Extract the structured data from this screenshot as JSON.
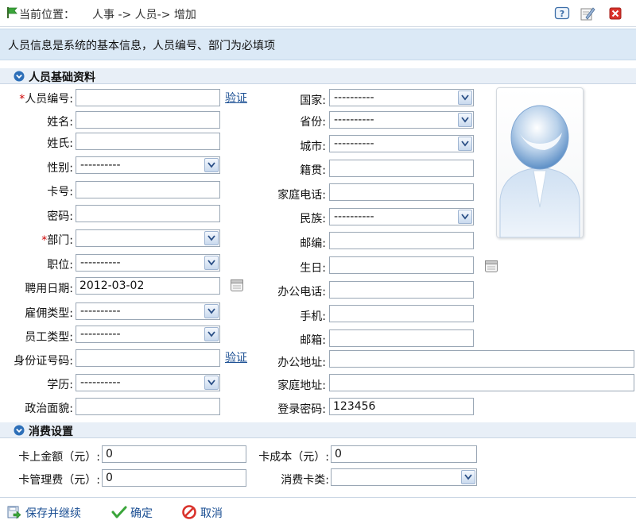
{
  "breadcrumb": {
    "label": "当前位置：",
    "path": "人事  -> 人员-> 增加"
  },
  "toolbar": {
    "help_icon": "help-icon",
    "edit_icon": "edit-icon",
    "close_icon": "close-icon"
  },
  "banner": {
    "text": "人员信息是系统的基本信息，人员编号、部门为必填项"
  },
  "section_basic": {
    "title": "人员基础资料"
  },
  "section_consume": {
    "title": "消费设置"
  },
  "left_fields": {
    "emp_no": {
      "required_mark": "*",
      "label": "人员编号:",
      "value": "",
      "verify_link": "验证"
    },
    "name": {
      "label": "姓名:",
      "value": ""
    },
    "surname": {
      "label": "姓氏:",
      "value": ""
    },
    "gender": {
      "label": "性别:",
      "value": "----------"
    },
    "card_no": {
      "label": "卡号:",
      "value": ""
    },
    "password": {
      "label": "密码:",
      "value": ""
    },
    "department": {
      "required_mark": "*",
      "label": "部门:",
      "value": ""
    },
    "position": {
      "label": "职位:",
      "value": "----------"
    },
    "hire_date": {
      "label": "聘用日期:",
      "value": "2012-03-02"
    },
    "employ_type": {
      "label": "雇佣类型:",
      "value": "----------"
    },
    "staff_type": {
      "label": "员工类型:",
      "value": "----------"
    },
    "id_no": {
      "label": "身份证号码:",
      "value": "",
      "verify_link": "验证"
    },
    "education": {
      "label": "学历:",
      "value": "----------"
    },
    "politics": {
      "label": "政治面貌:",
      "value": ""
    }
  },
  "right_fields": {
    "country": {
      "label": "国家:",
      "value": "----------"
    },
    "province": {
      "label": "省份:",
      "value": "----------"
    },
    "city": {
      "label": "城市:",
      "value": "----------"
    },
    "native_place": {
      "label": "籍贯:",
      "value": ""
    },
    "home_phone": {
      "label": "家庭电话:",
      "value": ""
    },
    "ethnicity": {
      "label": "民族:",
      "value": "----------"
    },
    "postcode": {
      "label": "邮编:",
      "value": ""
    },
    "birthday": {
      "label": "生日:",
      "value": ""
    },
    "office_phone": {
      "label": "办公电话:",
      "value": ""
    },
    "mobile": {
      "label": "手机:",
      "value": ""
    },
    "email": {
      "label": "邮箱:",
      "value": ""
    },
    "office_address": {
      "label": "办公地址:",
      "value": ""
    },
    "home_address": {
      "label": "家庭地址:",
      "value": ""
    },
    "login_password": {
      "label": "登录密码:",
      "value": "123456"
    }
  },
  "consume_fields": {
    "card_balance": {
      "label": "卡上金额（元）:",
      "value": "0"
    },
    "card_cost": {
      "label": "卡成本（元）:",
      "value": "0"
    },
    "card_fee": {
      "label": "卡管理费（元）:",
      "value": "0"
    },
    "card_type": {
      "label": "消费卡类:",
      "value": ""
    }
  },
  "actions": {
    "save_continue": "保存并继续",
    "confirm": "确定",
    "cancel": "取消"
  },
  "colors": {
    "banner_bg": "#dbe9f6",
    "section_bg": "#e8eff7",
    "link": "#1b4f93",
    "required": "#cc0000"
  }
}
